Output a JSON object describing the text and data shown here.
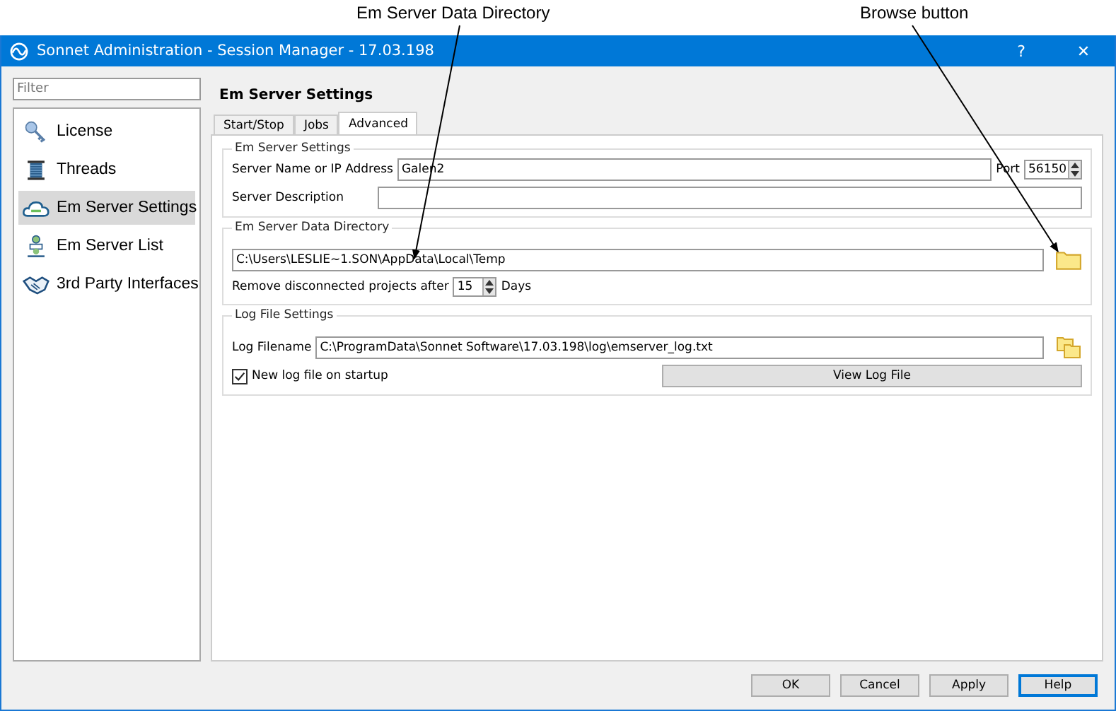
{
  "callouts": [
    {
      "label": "Em Server Data Directory"
    },
    {
      "label": "Browse button"
    }
  ],
  "window": {
    "title": "Sonnet Administration - Session Manager - 17.03.198",
    "help": "?",
    "close": "✕"
  },
  "sidebar": {
    "filter": {
      "placeholder": "Filter"
    },
    "items": [
      {
        "label": "License",
        "selected": false
      },
      {
        "label": "Threads",
        "selected": false
      },
      {
        "label": "Em Server Settings",
        "selected": true
      },
      {
        "label": "Em Server List",
        "selected": false
      },
      {
        "label": "3rd Party Interfaces",
        "selected": false
      }
    ]
  },
  "page": {
    "title": "Em Server Settings",
    "tabs": [
      {
        "label": "Start/Stop",
        "selected": false
      },
      {
        "label": "Jobs",
        "selected": false
      },
      {
        "label": "Advanced",
        "selected": true
      }
    ],
    "server_settings": {
      "title": "Em Server Settings",
      "name_label": "Server Name or IP Address",
      "name_value": "Galen2",
      "port_label": "Port",
      "port_value": "56150",
      "description_label": "Server Description"
    },
    "data_directory": {
      "title": "Em Server Data Directory",
      "path": "C:\\Users\\LESLIE~1.SON\\AppData\\Local\\Temp",
      "remove_label": "Remove disconnected projects after",
      "days_value": "15",
      "days_label": "Days"
    },
    "log_settings": {
      "title": "Log File Settings",
      "filename_label": "Log Filename",
      "filename": "C:\\ProgramData\\Sonnet Software\\17.03.198\\log\\emserver_log.txt",
      "new_log": {
        "label": "New log file on startup",
        "checked": true
      },
      "view_button": "View Log File"
    }
  },
  "buttons": [
    {
      "label": "OK",
      "default": false
    },
    {
      "label": "Cancel",
      "default": false
    },
    {
      "label": "Apply",
      "default": false
    },
    {
      "label": "Help",
      "default": true
    }
  ]
}
